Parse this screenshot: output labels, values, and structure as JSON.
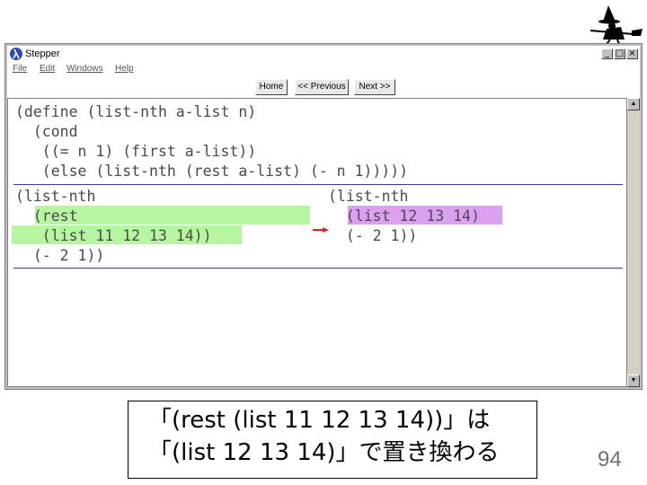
{
  "window": {
    "title": "Stepper",
    "controls": {
      "minimize": "_",
      "maximize": "□",
      "close": "×"
    },
    "menu": [
      "File",
      "Edit",
      "Windows",
      "Help"
    ]
  },
  "toolbar": {
    "home_label": "Home",
    "previous_label": "<< Previous",
    "next_label": "Next >>"
  },
  "definition": [
    "(define (list-nth a-list n)",
    "  (cond",
    "   ((= n 1) (first a-list))",
    "   (else (list-nth (rest a-list) (- n 1)))))"
  ],
  "before": [
    "(list-nth",
    "  (rest",
    "   (list 11 12 13 14))",
    "  (- 2 1))"
  ],
  "after": [
    "(list-nth",
    "  (list 12 13 14)",
    "  (- 2 1))"
  ],
  "colors": {
    "redex_highlight": "#b8f5a0",
    "contractum_highlight": "#dca0f0",
    "arrow": "#e02020"
  },
  "caption": {
    "line1": "「(rest (list 11 12 13 14))」は",
    "line2": "「(list 12 13 14)」で置き換わる"
  },
  "page_number": "94"
}
